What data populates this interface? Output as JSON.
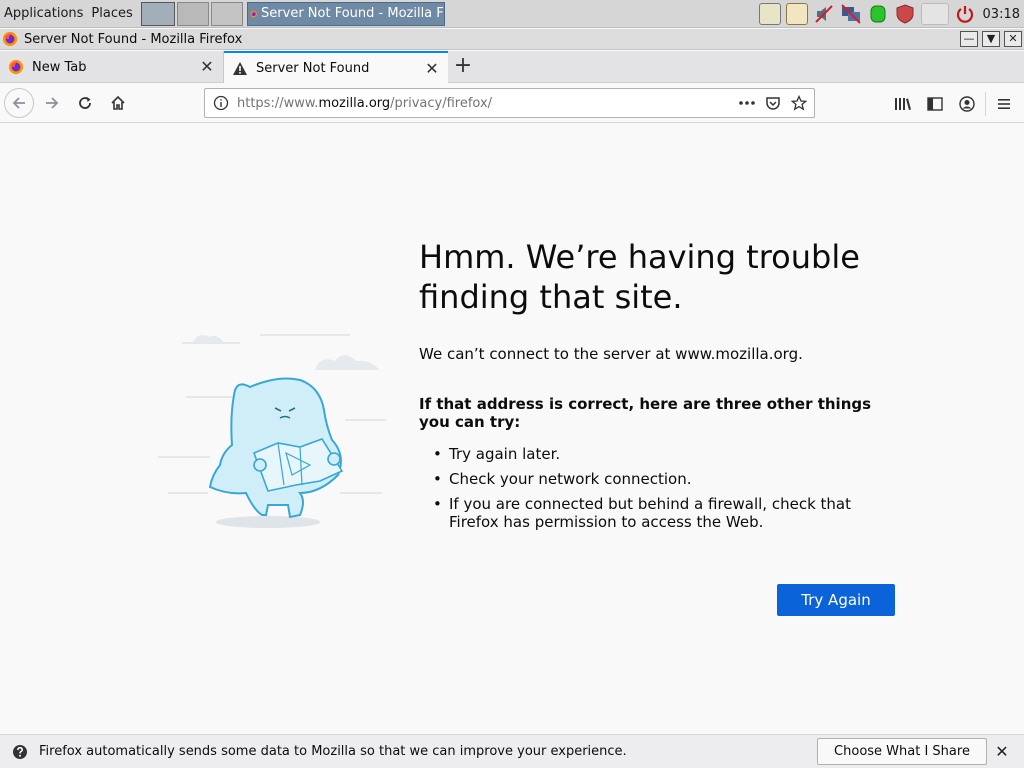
{
  "taskbar": {
    "applications_label": "Applications",
    "places_label": "Places",
    "task_title": "Server Not Found - Mozilla F",
    "clock": "03:18",
    "tray_icons": [
      "notes-icon",
      "clipboard-icon",
      "mute-icon",
      "network-disconnected-icon",
      "database-icon",
      "shield-icon",
      "blank-icon",
      "power-icon"
    ]
  },
  "window": {
    "title": "Server Not Found - Mozilla Firefox",
    "controls": [
      "minimize-icon",
      "maximize-icon",
      "close-icon"
    ]
  },
  "tabs": [
    {
      "label": "New Tab",
      "icon": "firefox-icon",
      "active": false
    },
    {
      "label": "Server Not Found",
      "icon": "warning-icon",
      "active": true
    }
  ],
  "navbar": {
    "url_prefix": "https://www.",
    "url_domain": "mozilla.org",
    "url_path": "/privacy/firefox/"
  },
  "error": {
    "title": "Hmm. We’re having trouble finding that site.",
    "description": "We can’t connect to the server at www.mozilla.org.",
    "subtitle": "If that address is correct, here are three other things you can try:",
    "suggestions": [
      "Try again later.",
      "Check your network connection.",
      "If you are connected but behind a firewall, check that Firefox has permission to access the Web."
    ],
    "button_label": "Try Again"
  },
  "notification": {
    "text": "Firefox automatically sends some data to Mozilla so that we can improve your experience.",
    "button_label": "Choose What I Share"
  },
  "colors": {
    "accent": "#0a84ff",
    "primary_button": "#0a63d9",
    "page_background": "#f9f9fa",
    "illustration_blue": "#4fb4d8"
  }
}
